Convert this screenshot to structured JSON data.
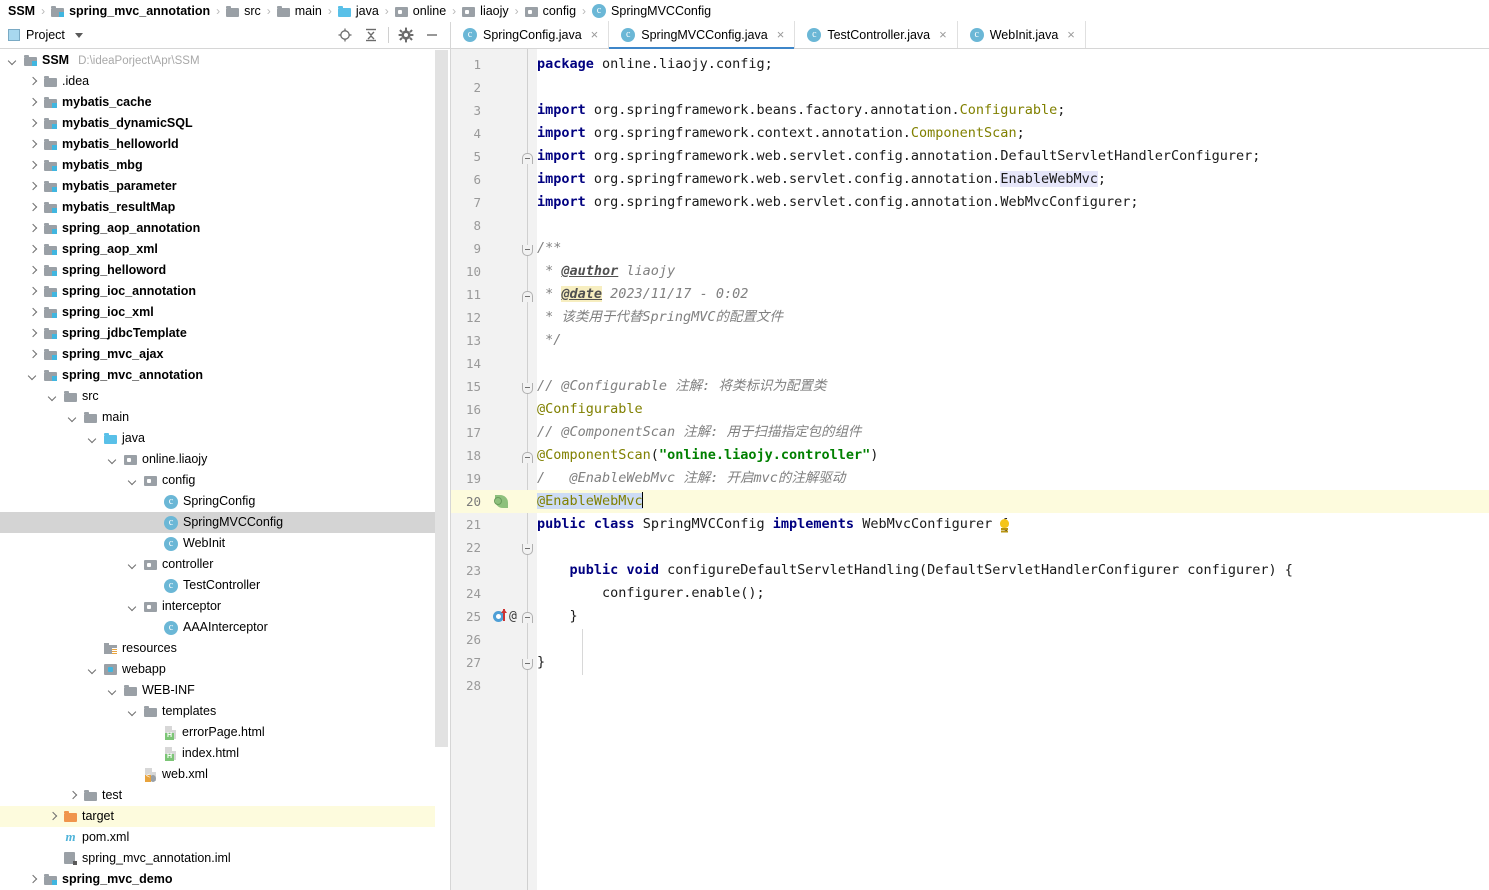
{
  "breadcrumb": {
    "items": [
      {
        "label": "SSM",
        "icon": "none",
        "bold": true
      },
      {
        "label": "spring_mvc_annotation",
        "icon": "module-icon",
        "bold": true
      },
      {
        "label": "src",
        "icon": "folder-icon",
        "bold": false
      },
      {
        "label": "main",
        "icon": "folder-icon",
        "bold": false
      },
      {
        "label": "java",
        "icon": "source-folder-icon",
        "bold": false
      },
      {
        "label": "online",
        "icon": "package-icon",
        "bold": false
      },
      {
        "label": "liaojy",
        "icon": "package-icon",
        "bold": false
      },
      {
        "label": "config",
        "icon": "package-icon",
        "bold": false
      },
      {
        "label": "SpringMVCConfig",
        "icon": "class-icon",
        "bold": false
      }
    ],
    "separator": "›"
  },
  "project_panel": {
    "title": "Project",
    "dropdown_caret": "▾",
    "tools": [
      {
        "name": "locate-in-tree-icon",
        "label": "Select Opened File"
      },
      {
        "name": "collapse-all-icon",
        "label": "Collapse All"
      },
      {
        "name": "gear-icon",
        "label": "Settings"
      },
      {
        "name": "minimize-icon",
        "label": "Hide"
      }
    ]
  },
  "tree": {
    "nodes": [
      {
        "label": "SSM",
        "path": "D:\\ideaPorject\\Apr\\SSM",
        "indent": 0,
        "arrow": "open",
        "icon": "module-icon",
        "bold": true,
        "state": "normal"
      },
      {
        "label": ".idea",
        "path": "",
        "indent": 1,
        "arrow": "closed",
        "icon": "folder-icon",
        "bold": false,
        "state": "normal"
      },
      {
        "label": "mybatis_cache",
        "path": "",
        "indent": 1,
        "arrow": "closed",
        "icon": "module-icon",
        "bold": true,
        "state": "normal"
      },
      {
        "label": "mybatis_dynamicSQL",
        "path": "",
        "indent": 1,
        "arrow": "closed",
        "icon": "module-icon",
        "bold": true,
        "state": "normal"
      },
      {
        "label": "mybatis_helloworld",
        "path": "",
        "indent": 1,
        "arrow": "closed",
        "icon": "module-icon",
        "bold": true,
        "state": "normal"
      },
      {
        "label": "mybatis_mbg",
        "path": "",
        "indent": 1,
        "arrow": "closed",
        "icon": "module-icon",
        "bold": true,
        "state": "normal"
      },
      {
        "label": "mybatis_parameter",
        "path": "",
        "indent": 1,
        "arrow": "closed",
        "icon": "module-icon",
        "bold": true,
        "state": "normal"
      },
      {
        "label": "mybatis_resultMap",
        "path": "",
        "indent": 1,
        "arrow": "closed",
        "icon": "module-icon",
        "bold": true,
        "state": "normal"
      },
      {
        "label": "spring_aop_annotation",
        "path": "",
        "indent": 1,
        "arrow": "closed",
        "icon": "module-icon",
        "bold": true,
        "state": "normal"
      },
      {
        "label": "spring_aop_xml",
        "path": "",
        "indent": 1,
        "arrow": "closed",
        "icon": "module-icon",
        "bold": true,
        "state": "normal"
      },
      {
        "label": "spring_helloword",
        "path": "",
        "indent": 1,
        "arrow": "closed",
        "icon": "module-icon",
        "bold": true,
        "state": "normal"
      },
      {
        "label": "spring_ioc_annotation",
        "path": "",
        "indent": 1,
        "arrow": "closed",
        "icon": "module-icon",
        "bold": true,
        "state": "normal"
      },
      {
        "label": "spring_ioc_xml",
        "path": "",
        "indent": 1,
        "arrow": "closed",
        "icon": "module-icon",
        "bold": true,
        "state": "normal"
      },
      {
        "label": "spring_jdbcTemplate",
        "path": "",
        "indent": 1,
        "arrow": "closed",
        "icon": "module-icon",
        "bold": true,
        "state": "normal"
      },
      {
        "label": "spring_mvc_ajax",
        "path": "",
        "indent": 1,
        "arrow": "closed",
        "icon": "module-icon",
        "bold": true,
        "state": "normal"
      },
      {
        "label": "spring_mvc_annotation",
        "path": "",
        "indent": 1,
        "arrow": "open",
        "icon": "module-icon",
        "bold": true,
        "state": "normal"
      },
      {
        "label": "src",
        "path": "",
        "indent": 2,
        "arrow": "open",
        "icon": "folder-icon",
        "bold": false,
        "state": "normal"
      },
      {
        "label": "main",
        "path": "",
        "indent": 3,
        "arrow": "open",
        "icon": "folder-icon",
        "bold": false,
        "state": "normal"
      },
      {
        "label": "java",
        "path": "",
        "indent": 4,
        "arrow": "open",
        "icon": "source-folder-icon",
        "bold": false,
        "state": "normal"
      },
      {
        "label": "online.liaojy",
        "path": "",
        "indent": 5,
        "arrow": "open",
        "icon": "package-icon",
        "bold": false,
        "state": "normal"
      },
      {
        "label": "config",
        "path": "",
        "indent": 6,
        "arrow": "open",
        "icon": "package-icon",
        "bold": false,
        "state": "normal"
      },
      {
        "label": "SpringConfig",
        "path": "",
        "indent": 7,
        "arrow": "none",
        "icon": "class-icon",
        "bold": false,
        "state": "normal"
      },
      {
        "label": "SpringMVCConfig",
        "path": "",
        "indent": 7,
        "arrow": "none",
        "icon": "class-icon",
        "bold": false,
        "state": "selected"
      },
      {
        "label": "WebInit",
        "path": "",
        "indent": 7,
        "arrow": "none",
        "icon": "class-icon",
        "bold": false,
        "state": "normal"
      },
      {
        "label": "controller",
        "path": "",
        "indent": 6,
        "arrow": "open",
        "icon": "package-icon",
        "bold": false,
        "state": "normal"
      },
      {
        "label": "TestController",
        "path": "",
        "indent": 7,
        "arrow": "none",
        "icon": "class-icon",
        "bold": false,
        "state": "normal"
      },
      {
        "label": "interceptor",
        "path": "",
        "indent": 6,
        "arrow": "open",
        "icon": "package-icon",
        "bold": false,
        "state": "normal"
      },
      {
        "label": "AAAInterceptor",
        "path": "",
        "indent": 7,
        "arrow": "none",
        "icon": "class-icon",
        "bold": false,
        "state": "normal"
      },
      {
        "label": "resources",
        "path": "",
        "indent": 4,
        "arrow": "none",
        "icon": "resources-folder-icon",
        "bold": false,
        "state": "normal"
      },
      {
        "label": "webapp",
        "path": "",
        "indent": 4,
        "arrow": "open",
        "icon": "webapp-folder-icon",
        "bold": false,
        "state": "normal"
      },
      {
        "label": "WEB-INF",
        "path": "",
        "indent": 5,
        "arrow": "open",
        "icon": "folder-icon",
        "bold": false,
        "state": "normal"
      },
      {
        "label": "templates",
        "path": "",
        "indent": 6,
        "arrow": "open",
        "icon": "folder-icon",
        "bold": false,
        "state": "normal"
      },
      {
        "label": "errorPage.html",
        "path": "",
        "indent": 7,
        "arrow": "none",
        "icon": "html-file-icon",
        "bold": false,
        "state": "normal"
      },
      {
        "label": "index.html",
        "path": "",
        "indent": 7,
        "arrow": "none",
        "icon": "html-file-icon",
        "bold": false,
        "state": "normal"
      },
      {
        "label": "web.xml",
        "path": "",
        "indent": 6,
        "arrow": "none",
        "icon": "xml-file-icon",
        "bold": false,
        "state": "normal"
      },
      {
        "label": "test",
        "path": "",
        "indent": 3,
        "arrow": "closed",
        "icon": "folder-icon",
        "bold": false,
        "state": "normal"
      },
      {
        "label": "target",
        "path": "",
        "indent": 2,
        "arrow": "closed",
        "icon": "excluded-folder-icon",
        "bold": false,
        "state": "highlight"
      },
      {
        "label": "pom.xml",
        "path": "",
        "indent": 2,
        "arrow": "none",
        "icon": "maven-file-icon",
        "bold": false,
        "state": "normal"
      },
      {
        "label": "spring_mvc_annotation.iml",
        "path": "",
        "indent": 2,
        "arrow": "none",
        "icon": "iml-file-icon",
        "bold": false,
        "state": "normal"
      },
      {
        "label": "spring_mvc_demo",
        "path": "",
        "indent": 1,
        "arrow": "closed",
        "icon": "module-icon",
        "bold": true,
        "state": "normal"
      }
    ]
  },
  "editor_tabs": [
    {
      "label": "SpringConfig.java",
      "icon": "class-icon",
      "close": "×",
      "active": false
    },
    {
      "label": "SpringMVCConfig.java",
      "icon": "class-icon",
      "close": "×",
      "active": true
    },
    {
      "label": "TestController.java",
      "icon": "class-icon",
      "close": "×",
      "active": false
    },
    {
      "label": "WebInit.java",
      "icon": "class-icon",
      "close": "×",
      "active": false
    }
  ],
  "editor": {
    "current_line": 20,
    "caret_line": 20,
    "selection_text": "@EnableWebMvc",
    "lines": [
      {
        "n": 1,
        "plain": "package online.liaojy.config;"
      },
      {
        "n": 2,
        "plain": ""
      },
      {
        "n": 3,
        "plain": "import org.springframework.beans.factory.annotation.Configurable;"
      },
      {
        "n": 4,
        "plain": "import org.springframework.context.annotation.ComponentScan;"
      },
      {
        "n": 5,
        "plain": "import org.springframework.web.servlet.config.annotation.DefaultServletHandlerConfigurer;"
      },
      {
        "n": 6,
        "plain": "import org.springframework.web.servlet.config.annotation.EnableWebMvc;"
      },
      {
        "n": 7,
        "plain": "import org.springframework.web.servlet.config.annotation.WebMvcConfigurer;"
      },
      {
        "n": 8,
        "plain": ""
      },
      {
        "n": 9,
        "plain": "/**"
      },
      {
        "n": 10,
        "plain": " * @author liaojy"
      },
      {
        "n": 11,
        "plain": " * @date 2023/11/17 - 0:02"
      },
      {
        "n": 12,
        "plain": " * 该类用于代替SpringMVC的配置文件"
      },
      {
        "n": 13,
        "plain": " */"
      },
      {
        "n": 14,
        "plain": ""
      },
      {
        "n": 15,
        "plain": "// @Configurable 注解: 将类标识为配置类"
      },
      {
        "n": 16,
        "plain": "@Configurable"
      },
      {
        "n": 17,
        "plain": "// @ComponentScan 注解: 用于扫描指定包的组件"
      },
      {
        "n": 18,
        "plain": "@ComponentScan(\"online.liaojy.controller\")"
      },
      {
        "n": 19,
        "plain": "// @EnableWebMvc 注解: 开启mvc的注解驱动"
      },
      {
        "n": 20,
        "plain": "@EnableWebMvc"
      },
      {
        "n": 21,
        "plain": "public class SpringMVCConfig implements WebMvcConfigurer {"
      },
      {
        "n": 22,
        "plain": ""
      },
      {
        "n": 23,
        "plain": "    public void configureDefaultServletHandling(DefaultServletHandlerConfigurer configurer) {"
      },
      {
        "n": 24,
        "plain": "        configurer.enable();"
      },
      {
        "n": 25,
        "plain": "    }"
      },
      {
        "n": 26,
        "plain": ""
      },
      {
        "n": 27,
        "plain": "}"
      },
      {
        "n": 28,
        "plain": ""
      }
    ],
    "gutter_marks": [
      {
        "line": 18,
        "name": "spring-bean-gutter-icon"
      },
      {
        "line": 23,
        "name": "overridden-method-gutter-icon"
      },
      {
        "line": 23,
        "name": "annotation-gutter-marker",
        "text": "@"
      }
    ]
  },
  "colors": {
    "accent": "#3e86c9",
    "selection": "#cddcf5",
    "current_line": "#fdfbdd",
    "tree_selected": "#d4d4d4",
    "keyword": "#000080",
    "string": "#008000",
    "annotation": "#808000",
    "comment": "#808080",
    "gutter_bg": "#f2f2f2"
  }
}
